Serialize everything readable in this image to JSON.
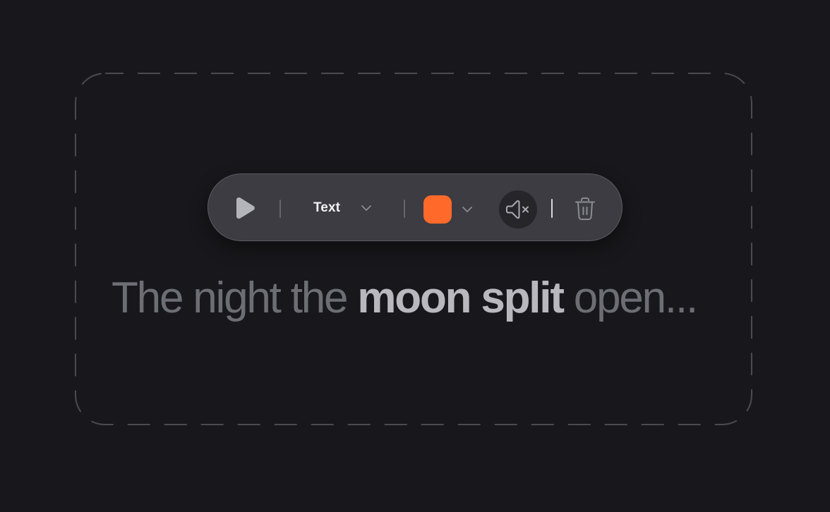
{
  "toolbar": {
    "play_icon": "play-icon",
    "type_dropdown": {
      "selected": "Text",
      "icon": "chevron-down-icon"
    },
    "color_dropdown": {
      "selected_color": "#ff6a2b",
      "icon": "chevron-down-icon"
    },
    "mute_icon": "speaker-muted-icon",
    "delete_icon": "trash-icon"
  },
  "caption": {
    "before": "The night the ",
    "emphasis": "moon split",
    "after": " open..."
  },
  "colors": {
    "background": "#18181c",
    "toolbar": "#3c3c42",
    "accent": "#ff6a2b",
    "frame_dash": "#4a4a50"
  }
}
